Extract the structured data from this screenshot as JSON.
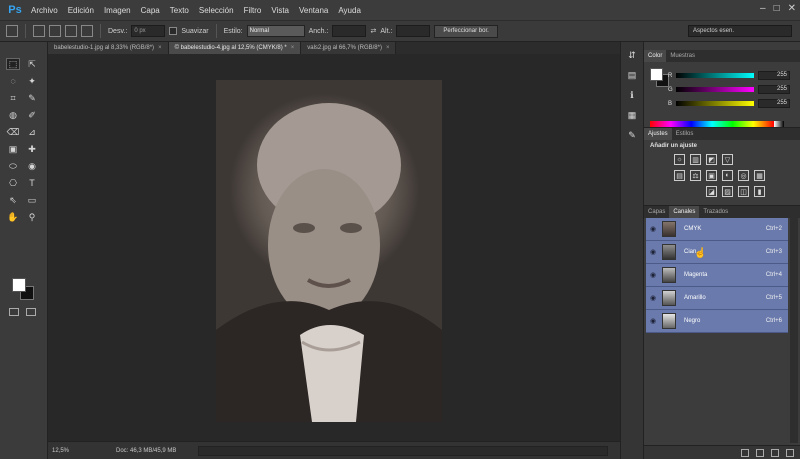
{
  "app": {
    "logo": "Ps",
    "menu": [
      "Archivo",
      "Edición",
      "Imagen",
      "Capa",
      "Texto",
      "Selección",
      "Filtro",
      "Vista",
      "Ventana",
      "Ayuda"
    ],
    "window_controls": [
      "–",
      "□",
      "✕"
    ]
  },
  "options": {
    "feather_label": "Desv.:",
    "feather_value": "0 px",
    "smooth_label": "Suavizar",
    "style_label": "Estilo:",
    "style_value": "Normal",
    "width_label": "Anch.:",
    "height_label": "Alt.:",
    "refine_label": "Perfeccionar bor.",
    "workspace_value": "Aspectos esen."
  },
  "tabs": [
    {
      "label": "babelestudio-1.jpg al 8,33% (RGB/8*)",
      "close": "×"
    },
    {
      "label": "© babelestudio-4.jpg al 12,5% (CMYK/8) *",
      "close": "×"
    },
    {
      "label": "vals2.jpg al 66,7% (RGB/8*)",
      "close": "×"
    }
  ],
  "status": {
    "zoom": "12,5%",
    "doc": "Doc: 46,3 MB/45,9 MB"
  },
  "panels": {
    "color_tabs": [
      "Color",
      "Muestras"
    ],
    "sliders": [
      {
        "label": "R",
        "value": "255",
        "gradient": "#00ffff"
      },
      {
        "label": "G",
        "value": "255",
        "gradient": "#ff00ff"
      },
      {
        "label": "B",
        "value": "255",
        "gradient": "#ffff00"
      }
    ],
    "adjust_tabs": [
      "Ajustes",
      "Estilos"
    ],
    "adjust_title": "Añadir un ajuste",
    "adjust_icons": [
      "☼",
      "▥",
      "◩",
      "▽",
      "",
      "",
      "▤",
      "⚖",
      "▣",
      "◐",
      "◎",
      "▦",
      "",
      "",
      "◪",
      "▨",
      "◫",
      "▮"
    ],
    "channel_tabs": [
      "Capas",
      "Canales",
      "Trazados"
    ],
    "channels": [
      {
        "name": "CMYK",
        "shortcut": "Ctrl+2"
      },
      {
        "name": "Cian",
        "shortcut": "Ctrl+3"
      },
      {
        "name": "Magenta",
        "shortcut": "Ctrl+4"
      },
      {
        "name": "Amarillo",
        "shortcut": "Ctrl+5"
      },
      {
        "name": "Negro",
        "shortcut": "Ctrl+6"
      }
    ]
  },
  "tools": [
    "⬚",
    "⇱",
    "◌",
    "✦",
    "⌗",
    "✎",
    "◍",
    "✐",
    "⌫",
    "⊿",
    "▣",
    "✚",
    "⬭",
    "◉",
    "⎔",
    "T",
    "⇖",
    "▭",
    "✋",
    "⚲"
  ],
  "strip_icons": [
    "⇵",
    "▤",
    "ℹ",
    "▦",
    "✎"
  ]
}
